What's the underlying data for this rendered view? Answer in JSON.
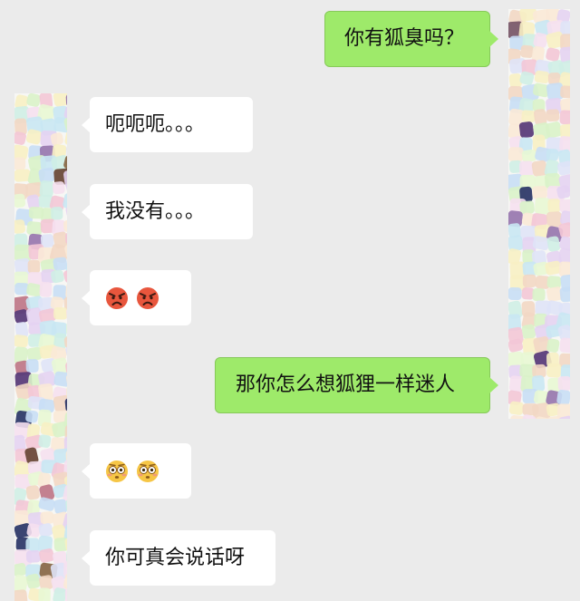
{
  "messages": [
    {
      "side": "right",
      "type": "text",
      "text": "你有狐臭吗？"
    },
    {
      "side": "left",
      "type": "text",
      "text": "呃呃呃。。。"
    },
    {
      "side": "left",
      "type": "text",
      "text": "我没有。。。"
    },
    {
      "side": "left",
      "type": "emoji",
      "emoji": [
        "pouting-face",
        "pouting-face"
      ]
    },
    {
      "side": "right",
      "type": "text",
      "text": "那你怎么想狐狸一样迷人"
    },
    {
      "side": "left",
      "type": "emoji",
      "emoji": [
        "flushed-face",
        "flushed-face"
      ]
    },
    {
      "side": "left",
      "type": "text",
      "text": "你可真会说话呀"
    }
  ],
  "colors": {
    "background": "#ebebeb",
    "incoming_bubble": "#ffffff",
    "outgoing_bubble": "#9eea6a"
  }
}
